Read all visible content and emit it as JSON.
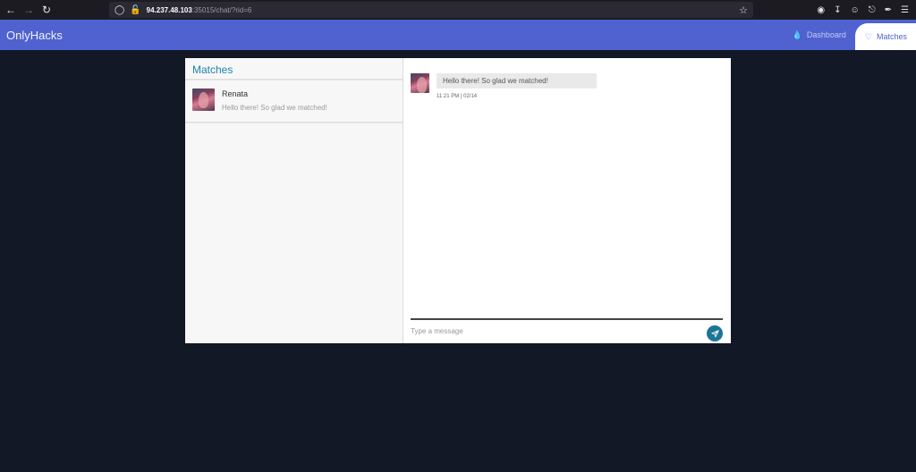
{
  "browser": {
    "url_host": "94.237.48.103",
    "url_rest": ":35015/chat/?rid=6"
  },
  "app": {
    "brand": "OnlyHacks",
    "nav": [
      {
        "label": "Dashboard",
        "icon": "flame-icon",
        "active": false
      },
      {
        "label": "Matches",
        "icon": "heart-icon",
        "active": true
      }
    ],
    "accent": "#4f62cf"
  },
  "matches": {
    "title": "Matches",
    "items": [
      {
        "name": "Renata",
        "preview": "Hello there! So glad we matched!"
      }
    ]
  },
  "chat": {
    "messages": [
      {
        "text": "Hello there! So glad we matched!",
        "time": "11:21 PM | 02/14"
      }
    ],
    "input_placeholder": "Type a message",
    "input_value": ""
  }
}
